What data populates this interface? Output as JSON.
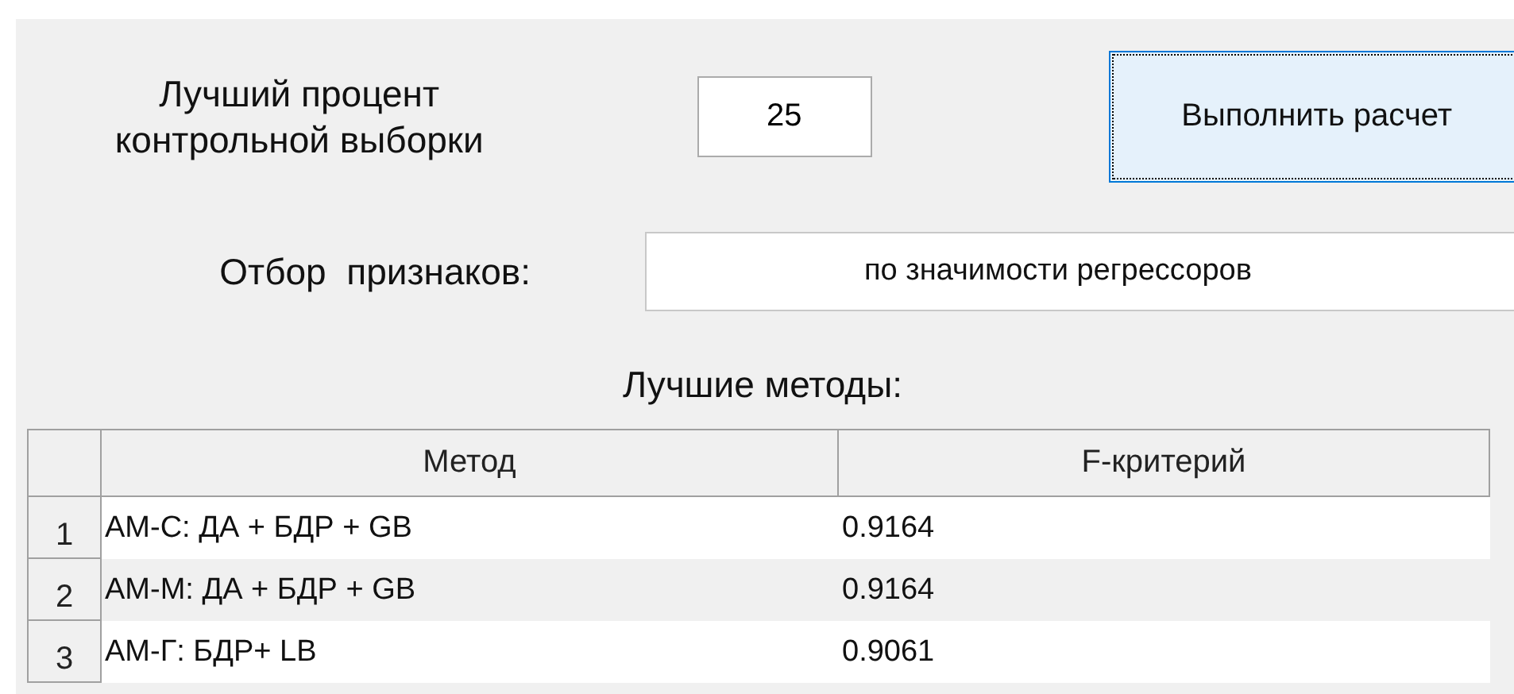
{
  "sample_label": "Лучший процент контрольной выборки",
  "sample_percent": {
    "value": "25"
  },
  "run_button": {
    "label": "Выполнить расчет"
  },
  "feature_selection": {
    "label": "Отбор  признаков:",
    "value": "по значимости регрессоров"
  },
  "best_methods": {
    "title": "Лучшие методы:",
    "columns": [
      "Метод",
      "F-критерий"
    ],
    "rows": [
      {
        "number": "1",
        "method": "АМ-С: ДА + БДР + GB",
        "f_value": "0.9164"
      },
      {
        "number": "2",
        "method": "АМ-М: ДА + БДР + GB",
        "f_value": "0.9164"
      },
      {
        "number": "3",
        "method": "АМ-Г: БДР+ LB",
        "f_value": "0.9061"
      }
    ]
  }
}
